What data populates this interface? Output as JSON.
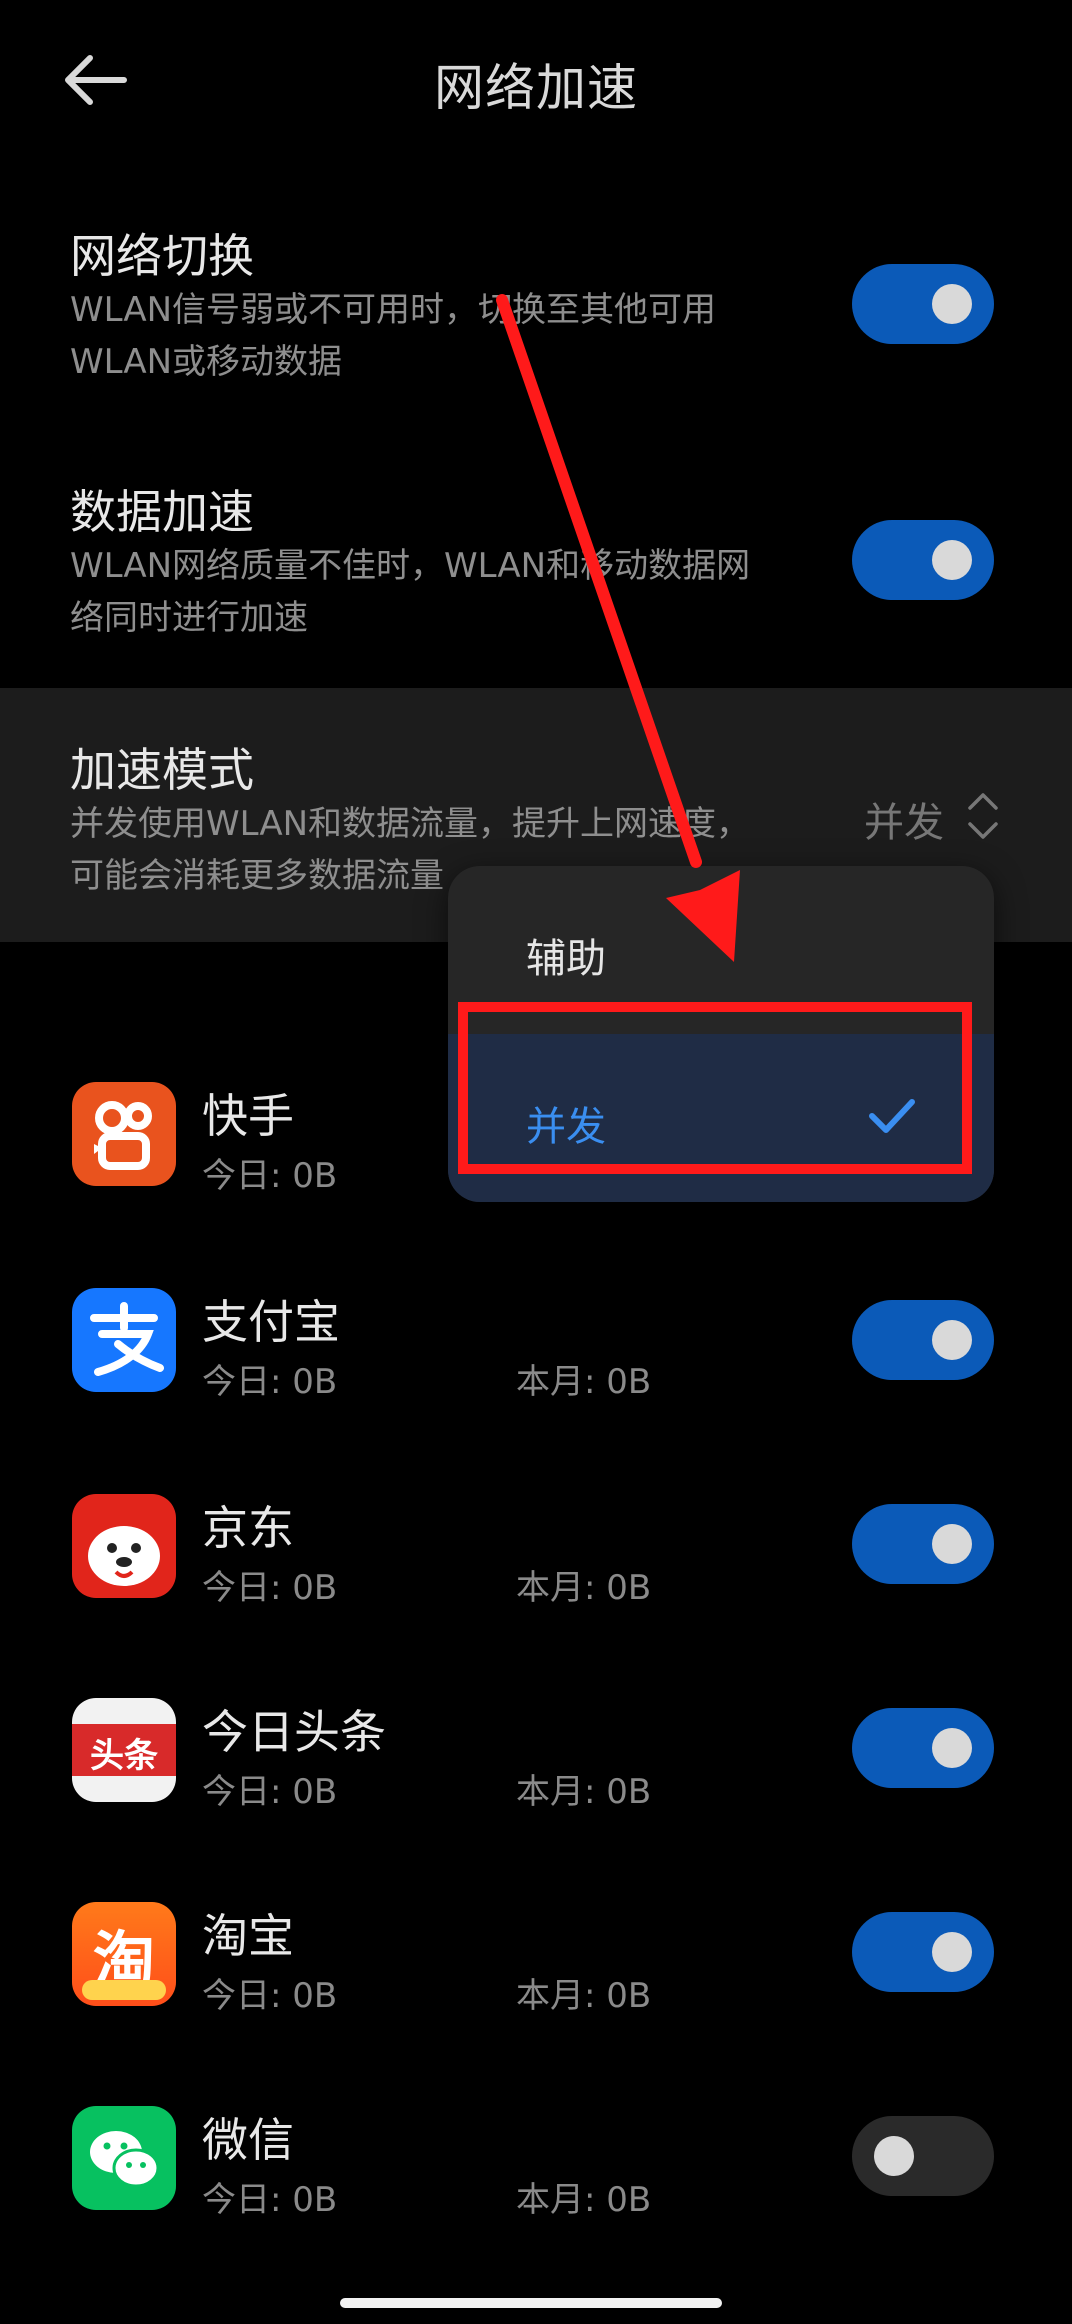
{
  "header": {
    "title": "网络加速"
  },
  "settings": {
    "network_switch": {
      "title": "网络切换",
      "desc_line1": "WLAN信号弱或不可用时，切换至其他可用",
      "desc_line2": "WLAN或移动数据",
      "enabled": true
    },
    "data_accel": {
      "title": "数据加速",
      "desc_line1": "WLAN网络质量不佳时，WLAN和移动数据网",
      "desc_line2": "络同时进行加速",
      "enabled": true
    },
    "accel_mode": {
      "title": "加速模式",
      "desc_line1": "并发使用WLAN和数据流量，提升上网速度，",
      "desc_line2": "可能会消耗更多数据流量",
      "value": "并发"
    }
  },
  "popup": {
    "options": [
      {
        "label": "辅助",
        "selected": false
      },
      {
        "label": "并发",
        "selected": true
      }
    ]
  },
  "apps": [
    {
      "name": "快手",
      "today": "今日: 0B",
      "month": "",
      "enabled": true,
      "icon": "kuaishou-icon"
    },
    {
      "name": "支付宝",
      "today": "今日: 0B",
      "month": "本月: 0B",
      "enabled": true,
      "icon": "alipay-icon"
    },
    {
      "name": "京东",
      "today": "今日: 0B",
      "month": "本月: 0B",
      "enabled": true,
      "icon": "jd-icon"
    },
    {
      "name": "今日头条",
      "today": "今日: 0B",
      "month": "本月: 0B",
      "enabled": true,
      "icon": "toutiao-icon"
    },
    {
      "name": "淘宝",
      "today": "今日: 0B",
      "month": "本月: 0B",
      "enabled": true,
      "icon": "taobao-icon"
    },
    {
      "name": "微信",
      "today": "今日: 0B",
      "month": "本月: 0B",
      "enabled": false,
      "icon": "wechat-icon"
    }
  ],
  "logos": {
    "toutiao_text": "头条",
    "taobao_text": "淘"
  },
  "colors": {
    "accent": "#0b5ab8",
    "selected_text": "#3a8ef0",
    "annotation": "#ff1a1a"
  }
}
